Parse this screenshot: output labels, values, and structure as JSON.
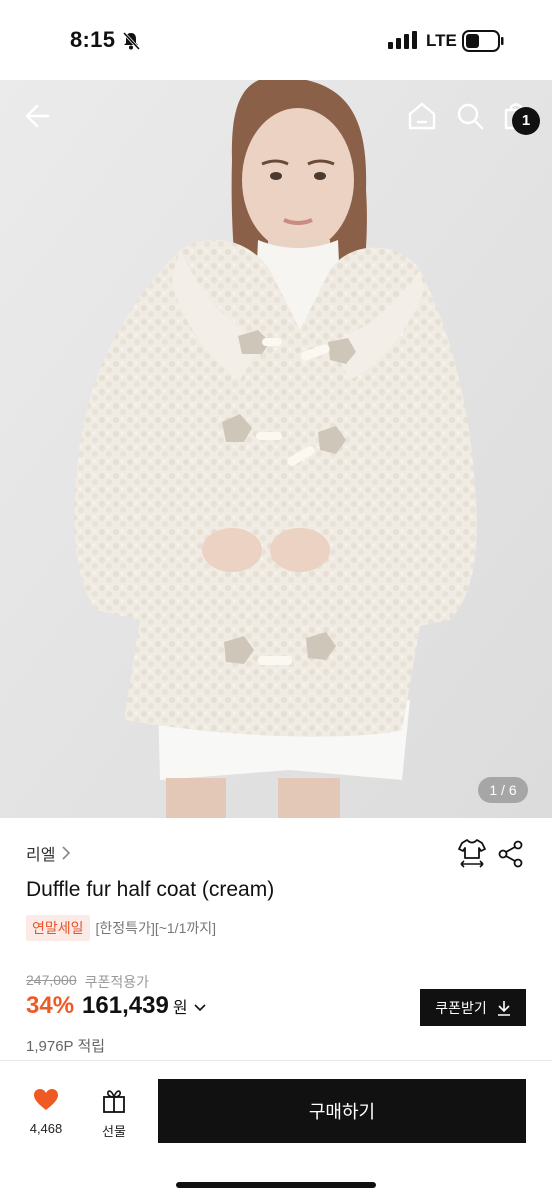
{
  "status_bar": {
    "time": "8:15",
    "network": "LTE"
  },
  "hero": {
    "image_counter": "1 / 6",
    "cart_count": "1"
  },
  "product": {
    "brand": "리엘",
    "title": "Duffle fur half coat (cream)",
    "sale_tag": "연말세일",
    "tag_note": "[한정특가][~1/1까지]",
    "original_price": "247,000",
    "coupon_note": "쿠폰적용가",
    "discount_rate": "34%",
    "sale_price": "161,439",
    "currency": "원",
    "points": "1,976P 적립"
  },
  "actions": {
    "coupon_button": "쿠폰받기",
    "like_count": "4,468",
    "gift_label": "선물",
    "buy_label": "구매하기"
  },
  "colors": {
    "discount": "#ef5a24",
    "sale_tag_bg": "#fbeae6",
    "sale_tag_text": "#e8542b",
    "like_heart": "#ef5a24"
  }
}
